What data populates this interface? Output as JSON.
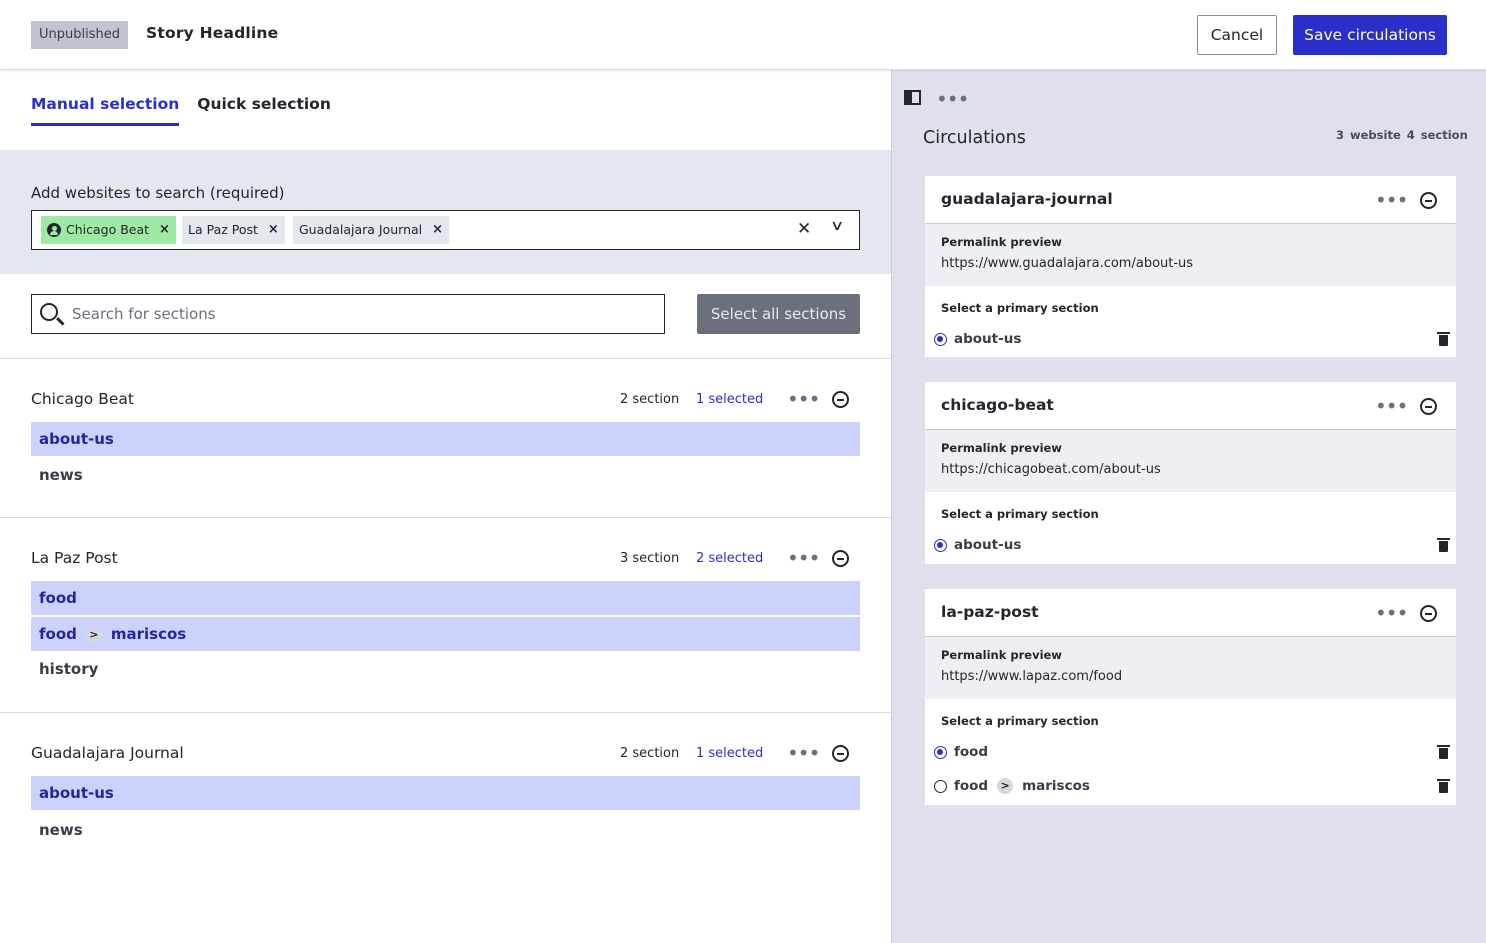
{
  "header": {
    "status_badge": "Unpublished",
    "title": "Story Headline",
    "cancel_label": "Cancel",
    "save_label": "Save circulations"
  },
  "tabs": [
    {
      "label": "Manual selection",
      "active": true
    },
    {
      "label": "Quick selection",
      "active": false
    }
  ],
  "websites": {
    "label": "Add websites to search (required)",
    "chips": [
      "Chicago Beat",
      "La Paz Post",
      "Guadalajara Journal"
    ]
  },
  "search": {
    "placeholder": "Search for sections",
    "select_all_label": "Select all sections"
  },
  "sites": [
    {
      "name": "Chicago Beat",
      "count": "2 section",
      "selected": "1 selected",
      "sections": [
        {
          "label": "about-us",
          "selected": true
        },
        {
          "label": "news",
          "selected": false
        }
      ]
    },
    {
      "name": "La Paz Post",
      "count": "3 section",
      "selected": "2 selected",
      "sections": [
        {
          "label": "food",
          "selected": true
        },
        {
          "label": "food",
          "child": "mariscos",
          "selected": true
        },
        {
          "label": "history",
          "selected": false
        }
      ]
    },
    {
      "name": "Guadalajara Journal",
      "count": "2 section",
      "selected": "1 selected",
      "sections": [
        {
          "label": "about-us",
          "selected": true
        },
        {
          "label": "news",
          "selected": false
        }
      ]
    }
  ],
  "circulations": {
    "title": "Circulations",
    "website_count": "3 website",
    "section_count": "4 section",
    "permalink_label": "Permalink preview",
    "primary_label": "Select a primary section",
    "cards": [
      {
        "name": "guadalajara-journal",
        "url": "https://www.guadalajara.com/about-us",
        "options": [
          {
            "label": "about-us",
            "checked": true
          }
        ]
      },
      {
        "name": "chicago-beat",
        "url": "https://chicagobeat.com/about-us",
        "options": [
          {
            "label": "about-us",
            "checked": true
          }
        ]
      },
      {
        "name": "la-paz-post",
        "url": "https://www.lapaz.com/food",
        "options": [
          {
            "label": "food",
            "checked": true
          },
          {
            "label": "food",
            "child": "mariscos",
            "checked": false
          }
        ]
      }
    ]
  },
  "colors": {
    "accent": "#2b2fc9",
    "selected_row": "#ccd2fb",
    "chip_green": "#9ee9a3",
    "panel_bg": "#dfe0ec"
  }
}
